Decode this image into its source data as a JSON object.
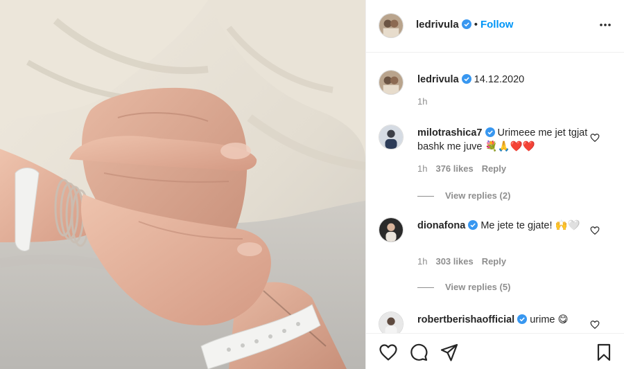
{
  "post": {
    "author": "ledrivula",
    "follow_label": "Follow",
    "separator": "•",
    "caption": "14.12.2020",
    "caption_time": "1h"
  },
  "comments": [
    {
      "user": "milotrashica7",
      "text": "Urimeee me jet tgjat bashk me juve",
      "emojis": "💐🙏❤️❤️",
      "time": "1h",
      "likes": "376 likes",
      "reply_label": "Reply",
      "view_replies": "View replies (2)"
    },
    {
      "user": "dionafona",
      "text": "Me jete te gjate!",
      "emojis": "🙌🤍",
      "time": "1h",
      "likes": "303 likes",
      "reply_label": "Reply",
      "view_replies": "View replies (5)"
    },
    {
      "user": "robertberishaofficial",
      "text": "urime",
      "emojis": "😋"
    }
  ],
  "icons": {
    "more": "more-options-icon",
    "like": "heart-icon",
    "comment": "comment-icon",
    "share": "share-icon",
    "save": "bookmark-icon",
    "verified": "verified-badge-icon"
  },
  "colors": {
    "accent": "#0095f6",
    "verified": "#3897f0",
    "text": "#262626",
    "secondary": "#8e8e8e",
    "heart_red": "#ed4956"
  }
}
